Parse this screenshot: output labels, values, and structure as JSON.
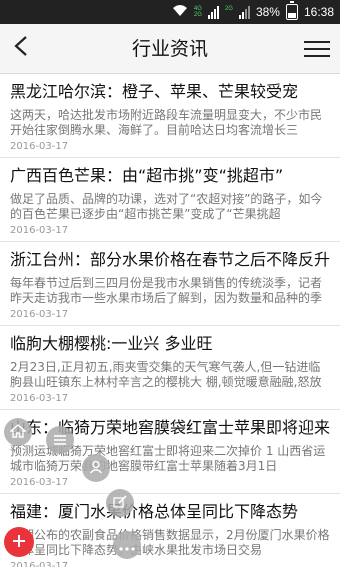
{
  "status_bar": {
    "battery": "38%",
    "time": "16:38",
    "network_top": "4G",
    "network_bottom": "2G",
    "sim2": "2G",
    "battery_level": 0.38
  },
  "header": {
    "title": "行业资讯",
    "back_icon": "back-arrow-icon",
    "menu_icon": "menu-icon"
  },
  "articles": [
    {
      "title": "黑龙江哈尔滨：橙子、苹果、芒果较受宠",
      "summary": "这两天，哈达批发市场附近路段车流量明显变大，不少市民开始往家倒腾水果、海鲜了。目前哈达日均客流增长三",
      "date": "2016-03-17"
    },
    {
      "title": "广西百色芒果：由“超市挑”变“挑超市”",
      "summary": "做足了品质、品牌的功课，选对了“农超对接”的路子，如今的百色芒果已逐步由“超市挑芒果”变成了“芒果挑超",
      "date": "2016-03-17"
    },
    {
      "title": "浙江台州：部分水果价格在春节之后不降反升",
      "summary": "每年春节过后到三四月份是我市水果销售的传统淡季，记者昨天走访我市一些水果市场后了解到，因为数量和品种的季",
      "date": "2016-03-17"
    },
    {
      "title": "临朐大棚樱桃:一业兴    多业旺",
      "summary": "2月23日,正月初五,雨夹雪交集的天气寒气袭人,但一钻进临朐县山旺镇东上林村辛言之的樱桃大 棚,顿觉暖意融融,怒放着的",
      "date": "2016-03-17"
    },
    {
      "title": "山东：临猗万荣地窖膜袋红富士苹果即将迎来",
      "summary": "预测运城临猗万荣地窖红富士即将迎来二次掉价    1 山西省运城市临猗万荣县的地窖膜带红富士苹果随着3月1日",
      "date": "2016-03-17"
    },
    {
      "title": "福建：厦门水果价格总体呈同比下降态势",
      "summary": "近期公布的农副食品价格销售数据显示，2月份厦门水果价格总体呈同比下降态势。由峡水果批发市场日交易",
      "date": "2016-03-17"
    }
  ],
  "floating_menu": [
    "home-icon",
    "list-icon",
    "user-icon",
    "edit-icon",
    "more-icon",
    "add-icon"
  ]
}
